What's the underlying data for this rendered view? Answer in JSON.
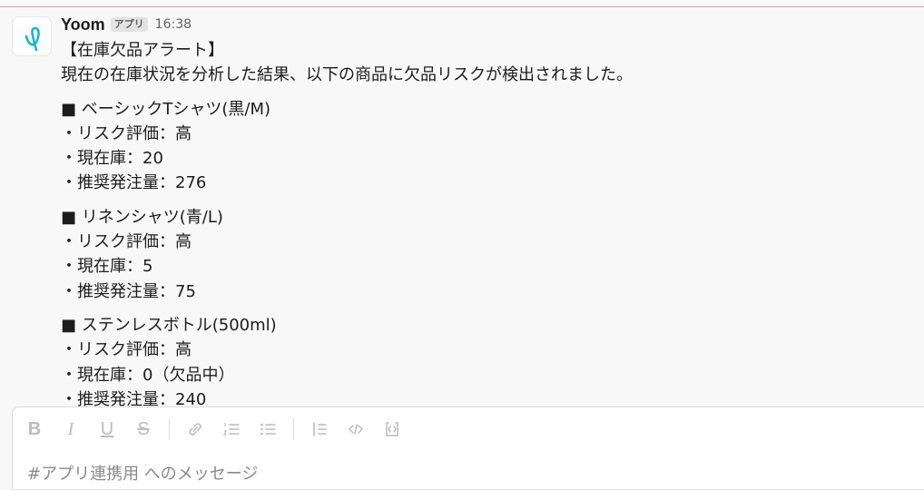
{
  "message": {
    "sender": "Yoom",
    "badge": "アプリ",
    "time": "16:38",
    "avatar": "yoom-logo-icon",
    "title": "【在庫欠品アラート】",
    "intro": "現在の在庫状況を分析した結果、以下の商品に欠品リスクが検出されました。",
    "items": [
      {
        "name": "■ ベーシックTシャツ(黒/M)",
        "risk": "・リスク評価：高",
        "stock": "・現在庫：20",
        "order": "・推奨発注量：276"
      },
      {
        "name": "■ リネンシャツ(青/L)",
        "risk": "・リスク評価：高",
        "stock": "・現在庫：5",
        "order": "・推奨発注量：75"
      },
      {
        "name": "■ ステンレスボトル(500ml)",
        "risk": "・リスク評価：高",
        "stock": "・現在庫：0（欠品中）",
        "order": "・推奨発注量：240"
      }
    ]
  },
  "composer": {
    "placeholder": "#アプリ連携用 へのメッセージ",
    "toolbar": [
      "bold-icon",
      "italic-icon",
      "underline-icon",
      "strikethrough-icon",
      "link-icon",
      "ordered-list-icon",
      "bulleted-list-icon",
      "blockquote-icon",
      "code-icon",
      "code-block-icon"
    ]
  },
  "colors": {
    "background": "#f8f8f8",
    "accent": "#1bb5c8",
    "top_border": "#c9a3c8"
  }
}
